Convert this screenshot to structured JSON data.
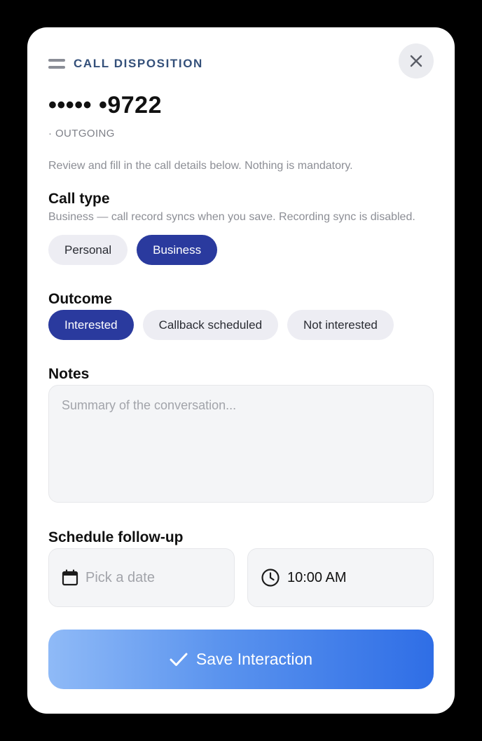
{
  "header": {
    "title": "CALL DISPOSITION",
    "menu_icon": "menu-icon",
    "close_icon": "close-icon"
  },
  "call": {
    "number": "••••• •9722",
    "direction": "· OUTGOING"
  },
  "intro_text": "Review and fill in the call details below. Nothing is mandatory.",
  "call_type": {
    "title": "Call type",
    "hint": "Business — call record syncs when you save. Recording sync is disabled.",
    "options": [
      "Personal",
      "Business"
    ],
    "selected": "Business"
  },
  "outcome": {
    "title": "Outcome",
    "options": [
      "Interested",
      "Callback scheduled",
      "Not interested"
    ],
    "selected": "Interested"
  },
  "notes": {
    "title": "Notes",
    "placeholder": "Summary of the conversation...",
    "value": ""
  },
  "follow_up": {
    "title": "Schedule follow-up",
    "date_placeholder": "Pick a date",
    "date_icon": "calendar-icon",
    "time_value": "10:00 AM",
    "time_icon": "clock-icon"
  },
  "save": {
    "label": "Save Interaction",
    "icon": "check-icon"
  },
  "colors": {
    "accent": "#2a3a9e",
    "header_title": "#34507a",
    "chip_bg": "#ededf3",
    "save_gradient_start": "#8fbaf7",
    "save_gradient_end": "#2f6ee6"
  }
}
